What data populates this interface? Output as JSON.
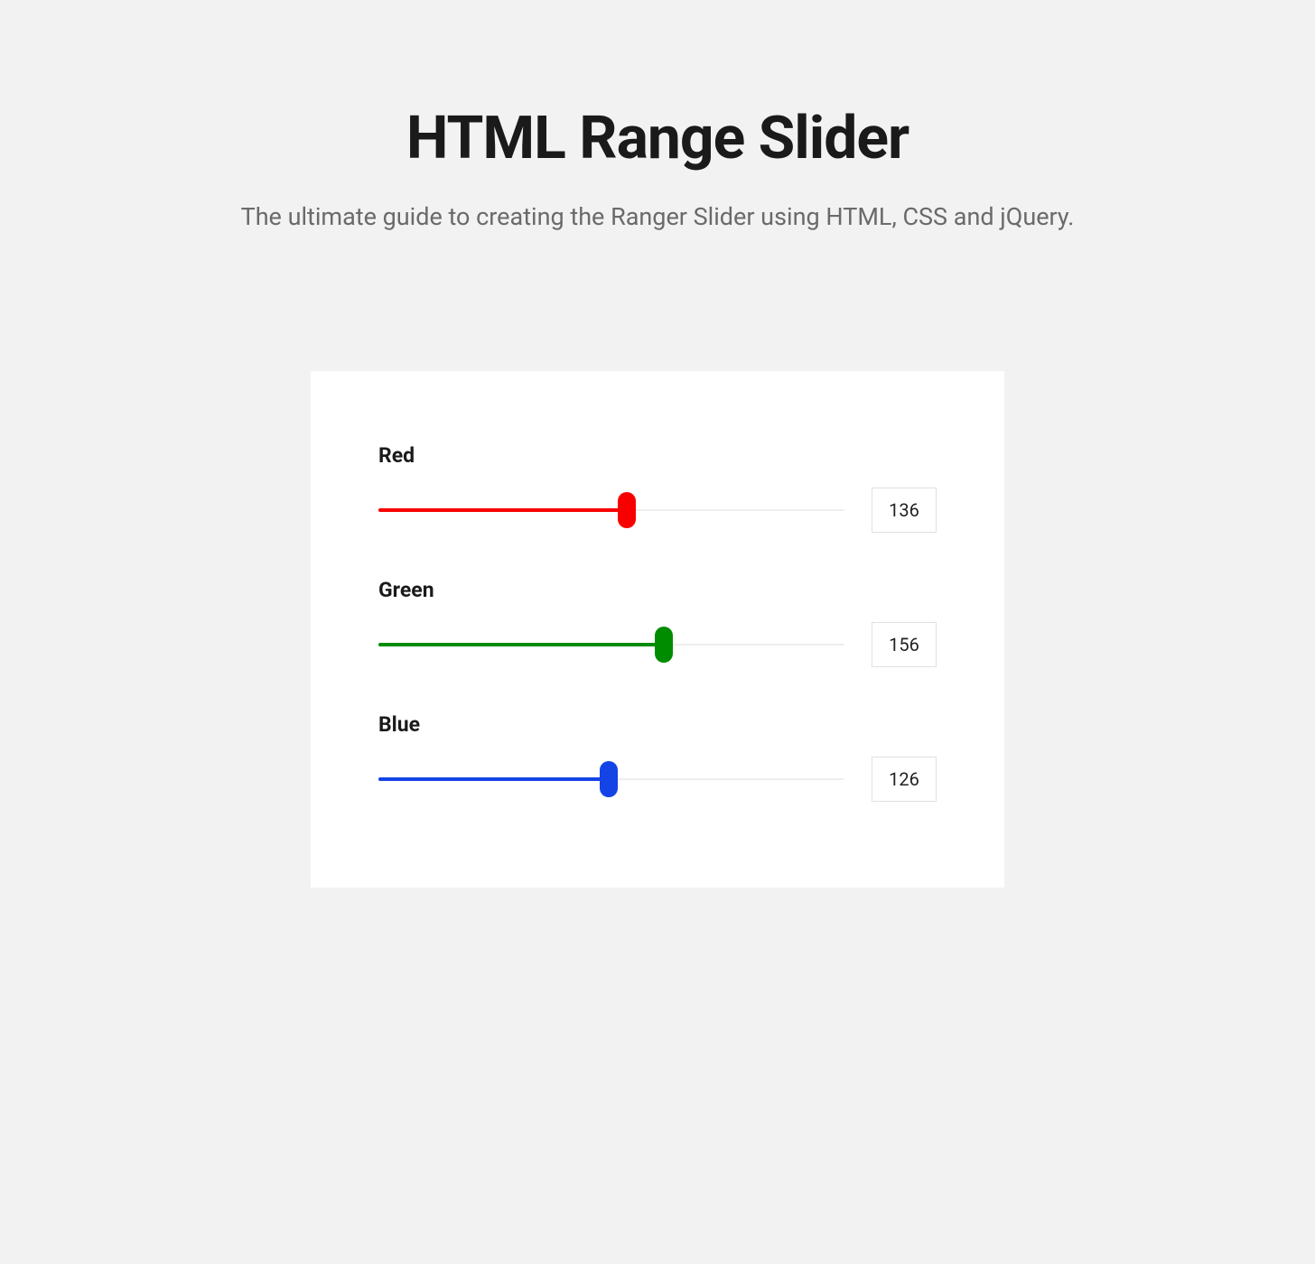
{
  "header": {
    "title": "HTML Range Slider",
    "subtitle": "The ultimate guide to creating the Ranger Slider using HTML, CSS and jQuery."
  },
  "sliders": {
    "max": 255,
    "red": {
      "label": "Red",
      "value": 136,
      "color": "#f80000"
    },
    "green": {
      "label": "Green",
      "value": 156,
      "color": "#008c00"
    },
    "blue": {
      "label": "Blue",
      "value": 126,
      "color": "#1443e6"
    }
  }
}
